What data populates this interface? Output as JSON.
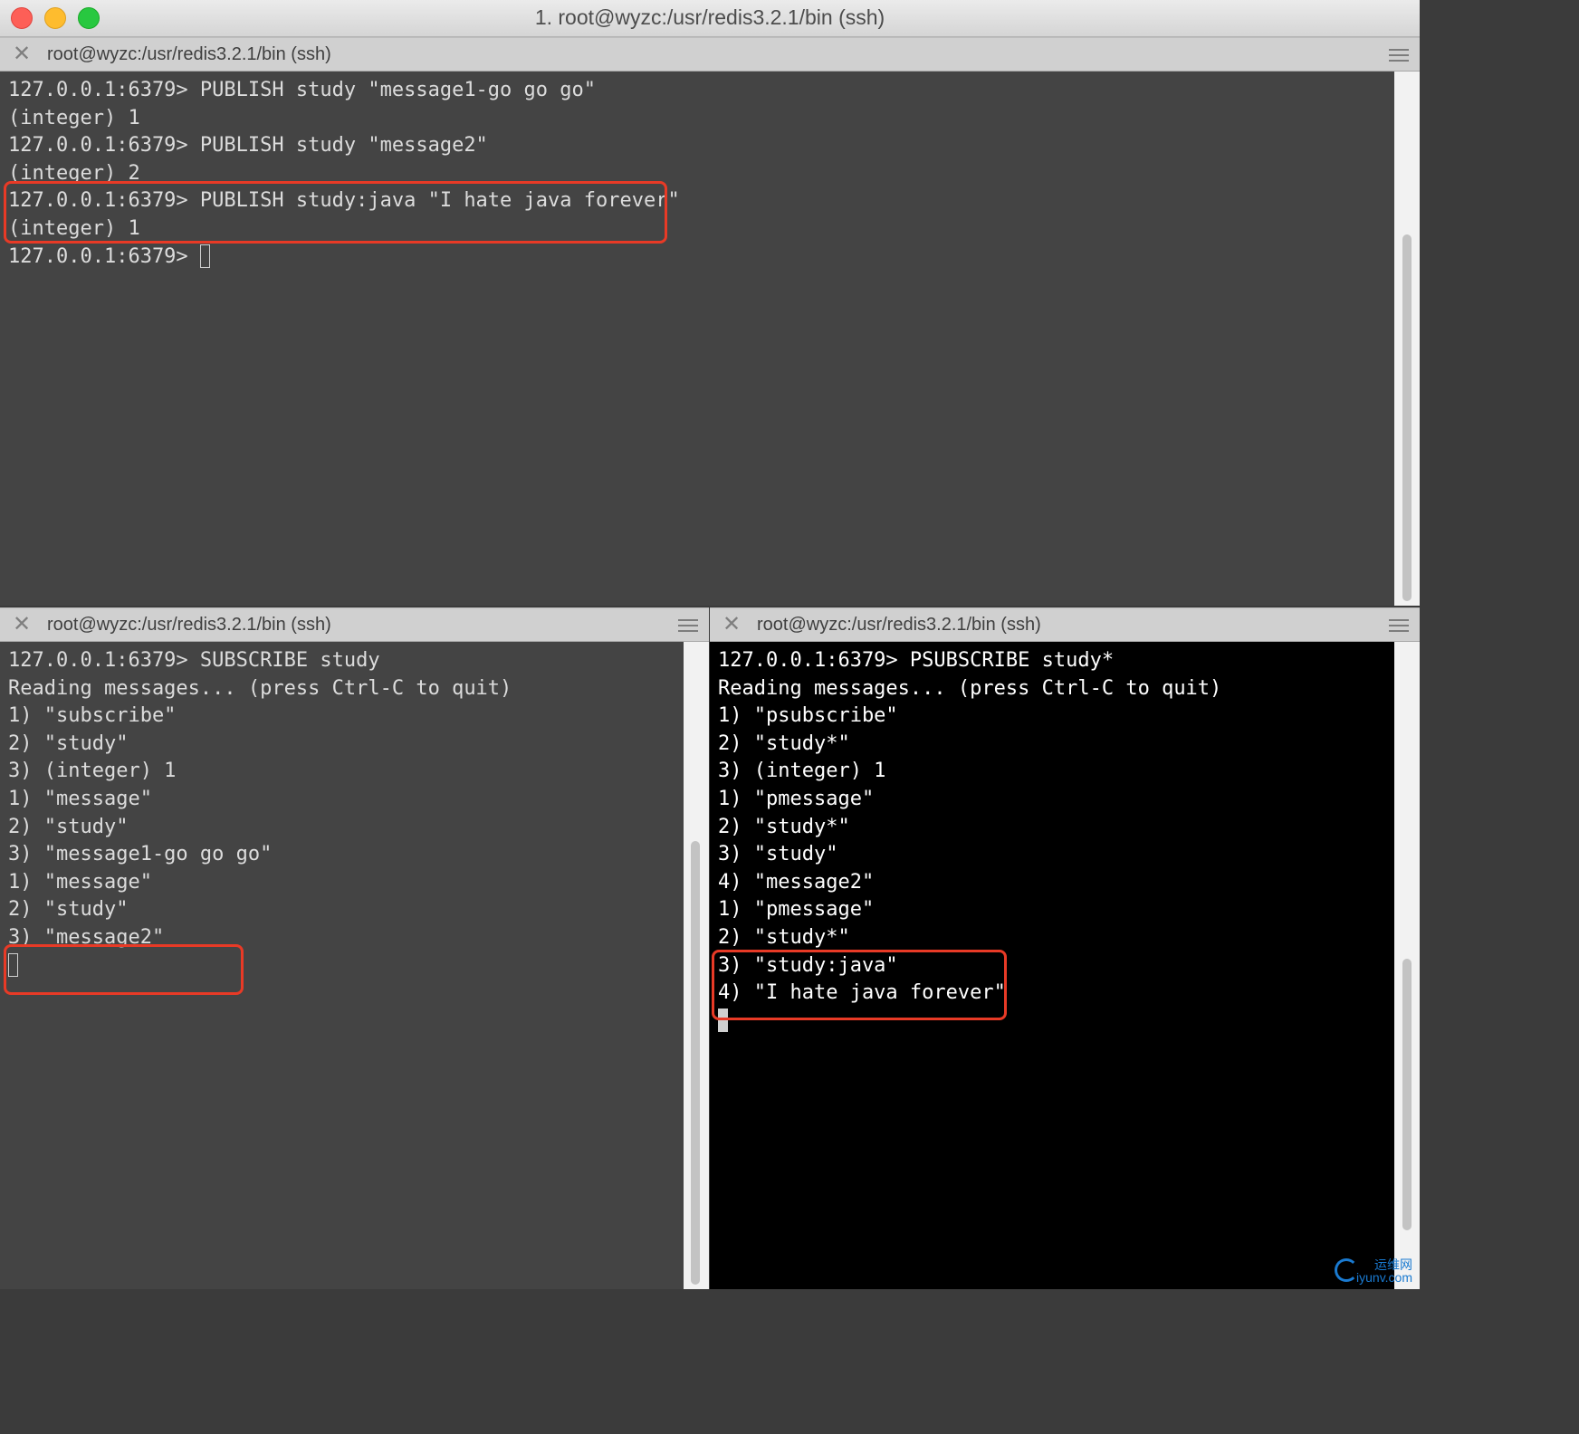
{
  "window": {
    "title": "1. root@wyzc:/usr/redis3.2.1/bin (ssh)"
  },
  "panes": {
    "top": {
      "title": "root@wyzc:/usr/redis3.2.1/bin (ssh)",
      "lines": [
        "127.0.0.1:6379> PUBLISH study \"message1-go go go\"",
        "(integer) 1",
        "127.0.0.1:6379> PUBLISH study \"message2\"",
        "(integer) 2",
        "127.0.0.1:6379> PUBLISH study:java \"I hate java forever\"",
        "(integer) 1",
        "127.0.0.1:6379> "
      ]
    },
    "bottom_left": {
      "title": "root@wyzc:/usr/redis3.2.1/bin (ssh)",
      "lines": [
        "127.0.0.1:6379> SUBSCRIBE study",
        "Reading messages... (press Ctrl-C to quit)",
        "1) \"subscribe\"",
        "2) \"study\"",
        "3) (integer) 1",
        "1) \"message\"",
        "2) \"study\"",
        "3) \"message1-go go go\"",
        "1) \"message\"",
        "2) \"study\"",
        "3) \"message2\""
      ]
    },
    "bottom_right": {
      "title": "root@wyzc:/usr/redis3.2.1/bin (ssh)",
      "lines": [
        "127.0.0.1:6379> PSUBSCRIBE study*",
        "Reading messages... (press Ctrl-C to quit)",
        "1) \"psubscribe\"",
        "2) \"study*\"",
        "3) (integer) 1",
        "1) \"pmessage\"",
        "2) \"study*\"",
        "3) \"study\"",
        "4) \"message2\"",
        "1) \"pmessage\"",
        "2) \"study*\"",
        "3) \"study:java\"",
        "4) \"I hate java forever\""
      ]
    }
  },
  "icons": {
    "close": "close-icon",
    "menu": "hamburger-menu-icon"
  },
  "colors": {
    "highlight_box": "#e83a26",
    "gray_pane_bg": "#444444",
    "black_pane_bg": "#000000"
  },
  "watermark": {
    "line1": "运维网",
    "line2": "iyunv.com"
  }
}
